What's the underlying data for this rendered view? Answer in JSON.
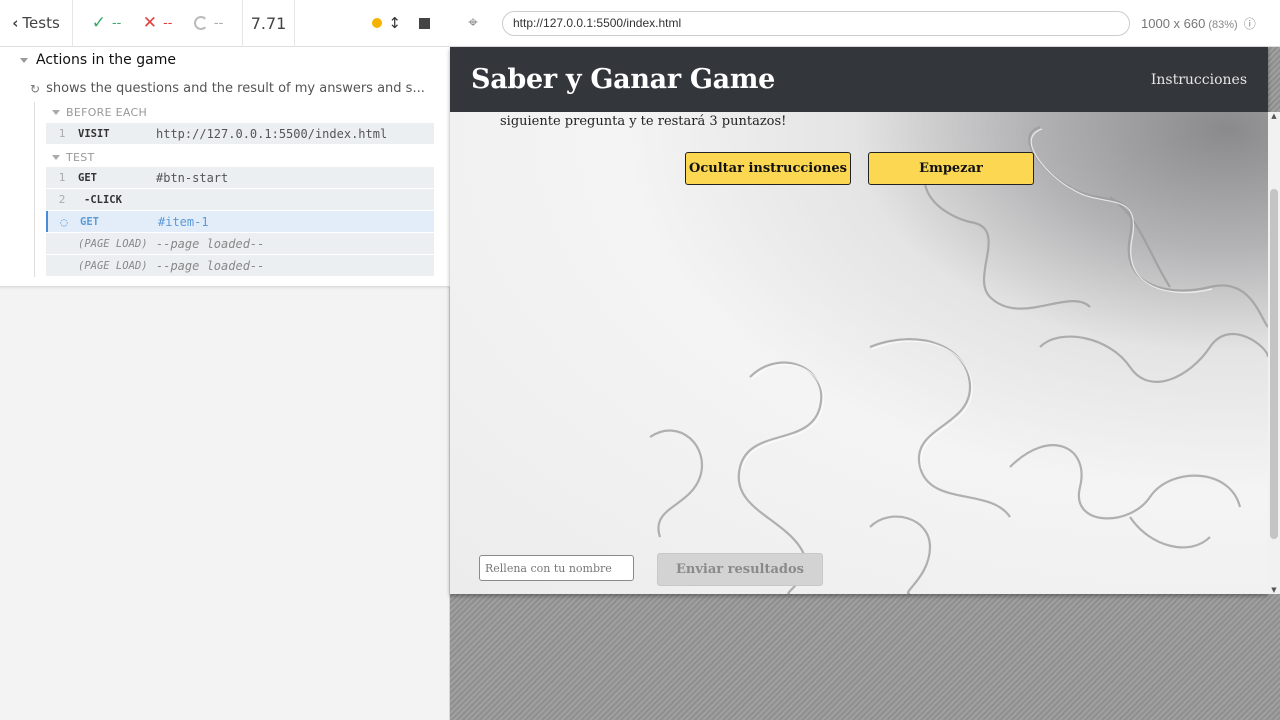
{
  "reporter": {
    "header": {
      "tests_label": "Tests",
      "passed": "--",
      "failed": "--",
      "pending": "--",
      "duration": "7.71"
    },
    "suite_title": "Actions in the game",
    "test_title": "shows the questions and the result of my answers and s...",
    "before_each_label": "BEFORE EACH",
    "test_label": "TEST",
    "commands": [
      {
        "num": "1",
        "name": "VISIT",
        "message": "http://127.0.0.1:5500/index.html"
      },
      {
        "num": "1",
        "name": "GET",
        "message": "#btn-start"
      },
      {
        "num": "2",
        "name": "-CLICK",
        "message": ""
      },
      {
        "num": "",
        "name": "GET",
        "message": "#item-1"
      },
      {
        "num": "",
        "name": "(PAGE LOAD)",
        "message": "--page loaded--"
      },
      {
        "num": "",
        "name": "(PAGE LOAD)",
        "message": "--page loaded--"
      }
    ]
  },
  "aut": {
    "url": "http://127.0.0.1:5500/index.html",
    "viewport": "1000 x 660",
    "scale": "(83%)"
  },
  "app": {
    "brand": "Saber y Ganar Game",
    "nav_link": "Instrucciones",
    "instructions_tail": "siguiente pregunta y te restará 3 puntazos!",
    "hide_instructions_button": "Ocultar instrucciones",
    "start_button": "Empezar",
    "name_placeholder": "Rellena con tu nombre",
    "send_button": "Enviar resultados"
  },
  "colors": {
    "navbar": "#33363b",
    "button_yellow": "#fcd752",
    "pass": "#3aa86b",
    "fail": "#e0413e",
    "running": "#f5b300",
    "active_command": "#5a9ad8"
  }
}
